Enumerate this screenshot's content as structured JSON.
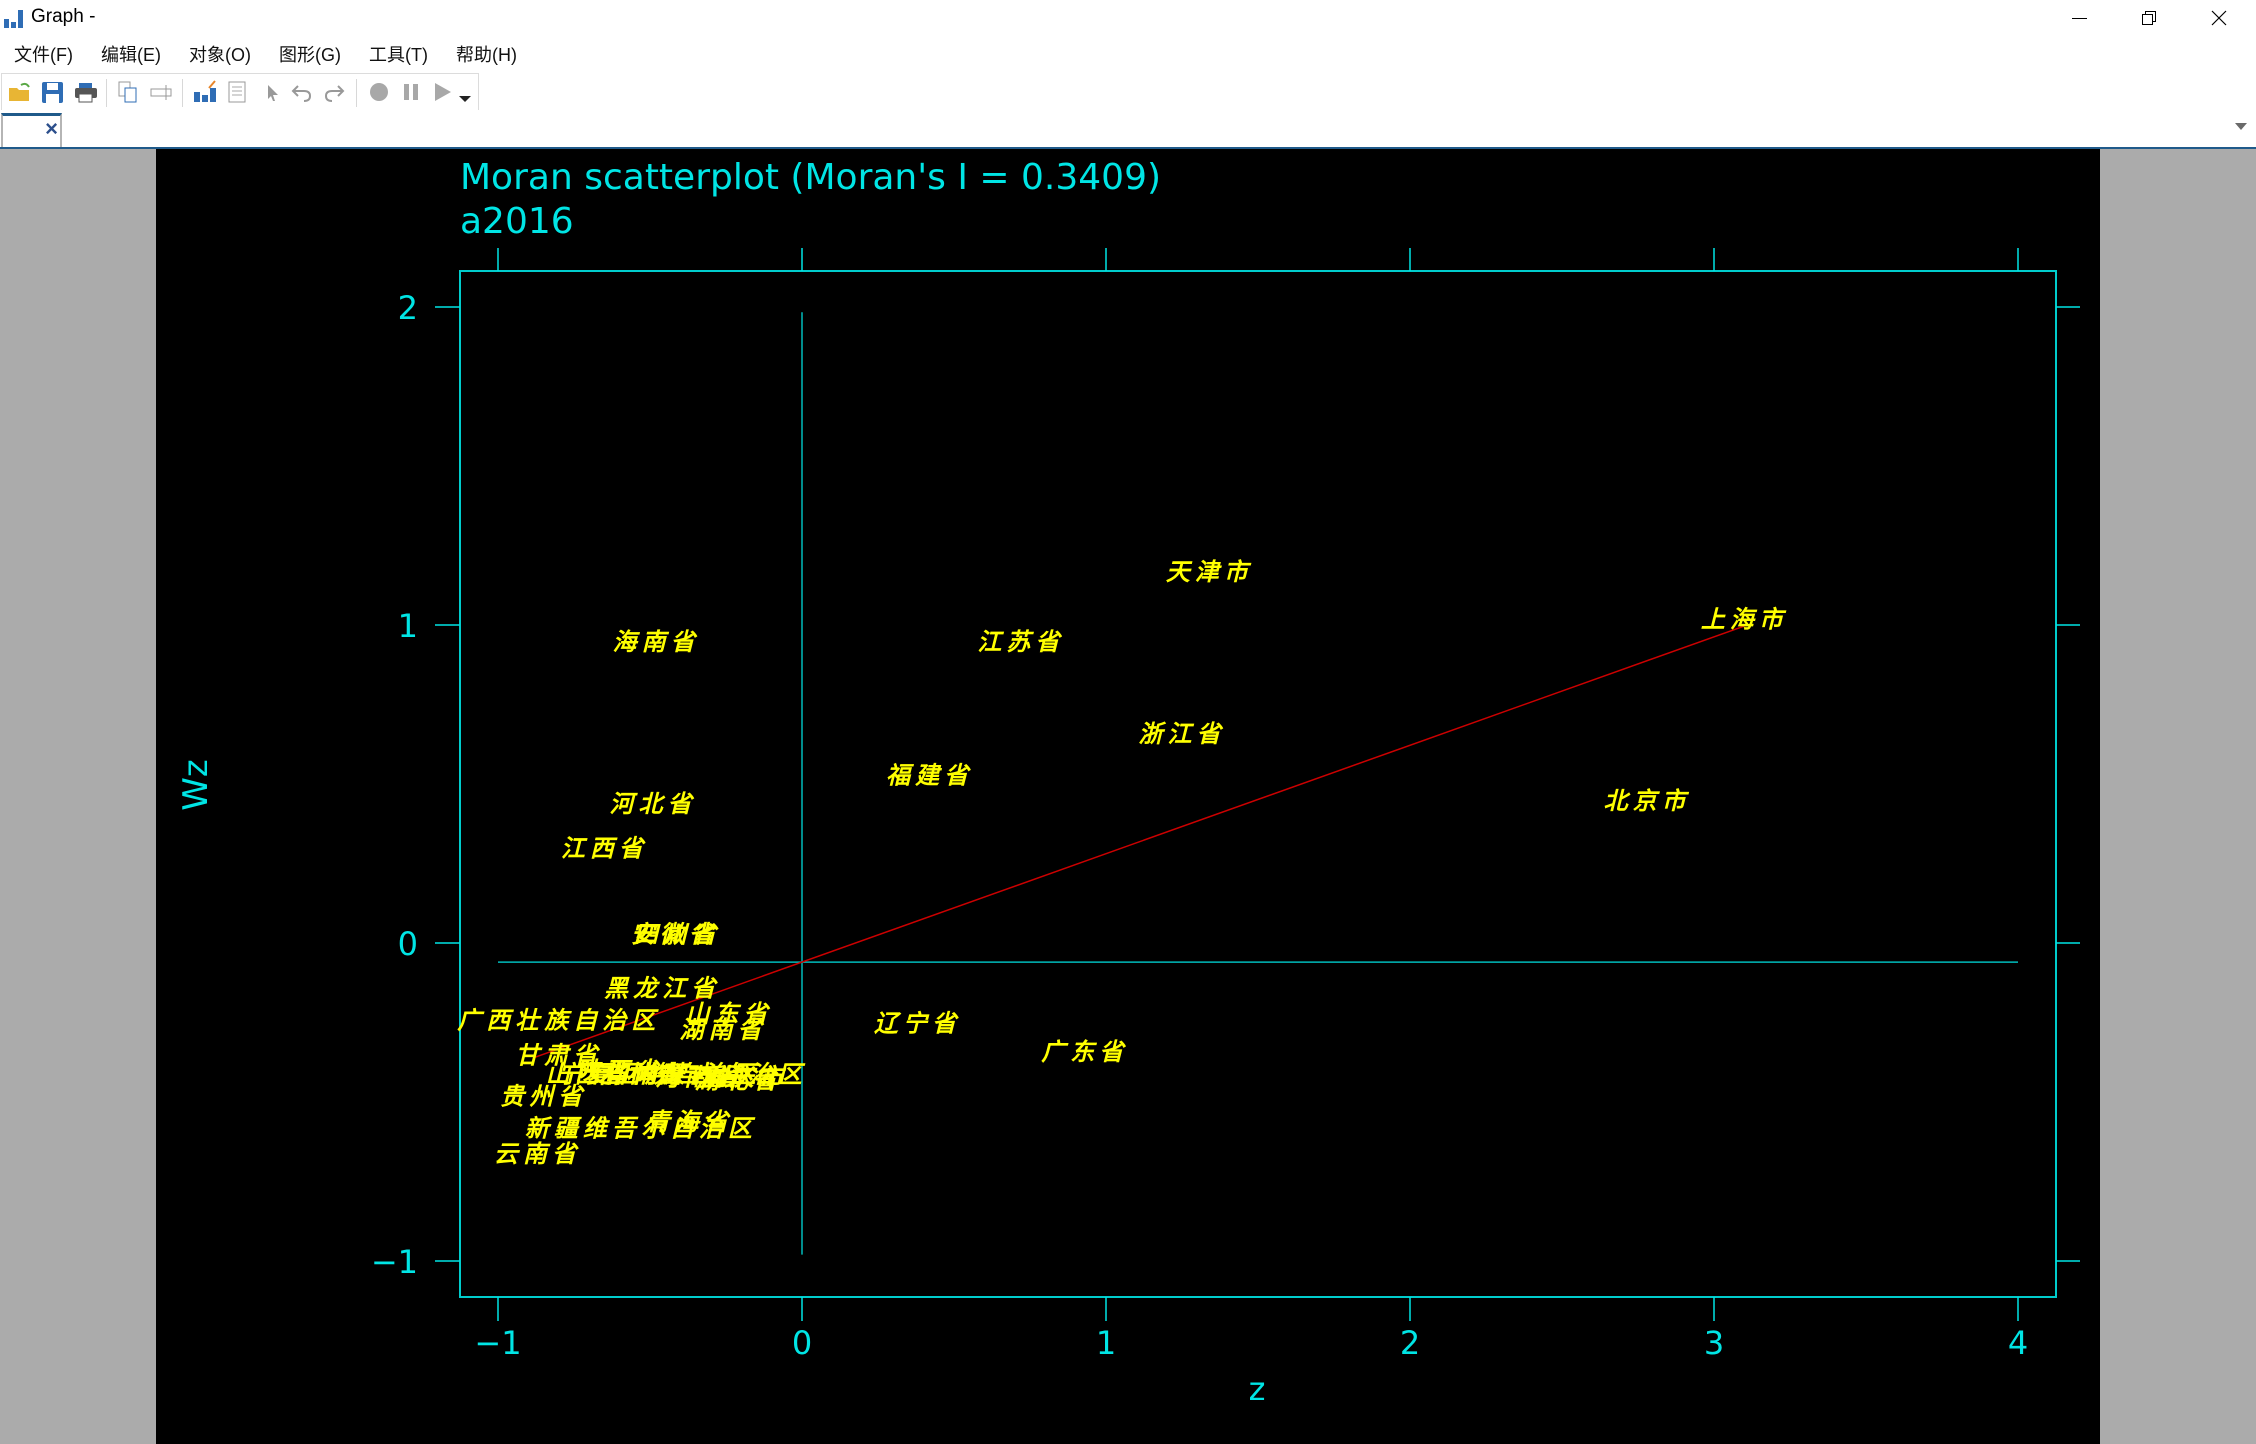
{
  "window": {
    "title": "Graph -",
    "controls": {
      "minimize": "—",
      "restore": "❐",
      "close": "✕"
    }
  },
  "menu": [
    {
      "label": "文件(F)"
    },
    {
      "label": "编辑(E)"
    },
    {
      "label": "对象(O)"
    },
    {
      "label": "图形(G)"
    },
    {
      "label": "工具(T)"
    },
    {
      "label": "帮助(H)"
    }
  ],
  "toolbar": {
    "buttons": [
      {
        "name": "open-icon"
      },
      {
        "name": "save-icon"
      },
      {
        "name": "print-icon"
      },
      {
        "name": "copy-icon"
      },
      {
        "name": "rename-icon"
      },
      {
        "name": "graph-editor-icon"
      },
      {
        "name": "object-browser-icon"
      },
      {
        "name": "pointer-icon"
      },
      {
        "name": "undo-icon"
      },
      {
        "name": "redo-icon"
      },
      {
        "name": "record-icon"
      },
      {
        "name": "pause-icon"
      },
      {
        "name": "play-icon"
      },
      {
        "name": "dropdown-icon"
      }
    ]
  },
  "tab": {
    "label": "",
    "close": "×"
  },
  "chart_data": {
    "type": "scatter",
    "title": "Moran scatterplot (Moran's I = 0.3409)",
    "subtitle": "a2016",
    "xlabel": "z",
    "ylabel": "Wz",
    "xlim": [
      -1.13,
      4.18
    ],
    "ylim": [
      -1.11,
      2.11
    ],
    "xticks": [
      -1,
      0,
      1,
      2,
      3,
      4
    ],
    "xtick_labels": [
      "−1",
      "0",
      "1",
      "2",
      "3",
      "4"
    ],
    "yticks": [
      -1,
      0,
      1,
      2
    ],
    "ytick_labels": [
      "−1",
      "0",
      "1",
      "2"
    ],
    "grid": false,
    "mean_z": 0,
    "mean_wz": -0.06,
    "fit_line": {
      "slope": 0.3409,
      "intercept": -0.06,
      "x_range": [
        -0.88,
        3.1
      ],
      "color": "#cc0000"
    },
    "colors": {
      "axis": "#00e5e5",
      "labels": "#ffff00",
      "background": "#000000"
    },
    "points": [
      {
        "label": "天津市",
        "z": 1.34,
        "wz": 1.17
      },
      {
        "label": "上海市",
        "z": 3.1,
        "wz": 1.02
      },
      {
        "label": "海南省",
        "z": -0.48,
        "wz": 0.95
      },
      {
        "label": "江苏省",
        "z": 0.72,
        "wz": 0.95
      },
      {
        "label": "浙江省",
        "z": 1.25,
        "wz": 0.66
      },
      {
        "label": "福建省",
        "z": 0.42,
        "wz": 0.53
      },
      {
        "label": "北京市",
        "z": 2.78,
        "wz": 0.45
      },
      {
        "label": "河北省",
        "z": -0.49,
        "wz": 0.44
      },
      {
        "label": "江西省",
        "z": -0.65,
        "wz": 0.3
      },
      {
        "label": "安徽省",
        "z": -0.42,
        "wz": 0.03
      },
      {
        "label": "四川省",
        "z": -0.41,
        "wz": 0.03
      },
      {
        "label": "黑龙江省",
        "z": -0.46,
        "wz": -0.14
      },
      {
        "label": "山东省",
        "z": -0.24,
        "wz": -0.22
      },
      {
        "label": "广西壮族自治区",
        "z": -0.8,
        "wz": -0.24
      },
      {
        "label": "湖南省",
        "z": -0.26,
        "wz": -0.27
      },
      {
        "label": "辽宁省",
        "z": 0.38,
        "wz": -0.25
      },
      {
        "label": "甘肃省",
        "z": -0.8,
        "wz": -0.35
      },
      {
        "label": "广东省",
        "z": 0.93,
        "wz": -0.34
      },
      {
        "label": "陕西省",
        "z": -0.6,
        "wz": -0.4
      },
      {
        "label": "山西省",
        "z": -0.7,
        "wz": -0.41
      },
      {
        "label": "吉林省",
        "z": -0.53,
        "wz": -0.41
      },
      {
        "label": "宁夏回族自治区",
        "z": -0.47,
        "wz": -0.41
      },
      {
        "label": "河南省",
        "z": -0.34,
        "wz": -0.42
      },
      {
        "label": "内蒙古自治区",
        "z": -0.27,
        "wz": -0.41
      },
      {
        "label": "湖北省",
        "z": -0.21,
        "wz": -0.43
      },
      {
        "label": "重庆市",
        "z": -0.19,
        "wz": -0.42
      },
      {
        "label": "贵州省",
        "z": -0.85,
        "wz": -0.48
      },
      {
        "label": "青海省",
        "z": -0.37,
        "wz": -0.56
      },
      {
        "label": "新疆维吾尔自治区",
        "z": -0.53,
        "wz": -0.58
      },
      {
        "label": "云南省",
        "z": -0.87,
        "wz": -0.66
      }
    ]
  }
}
